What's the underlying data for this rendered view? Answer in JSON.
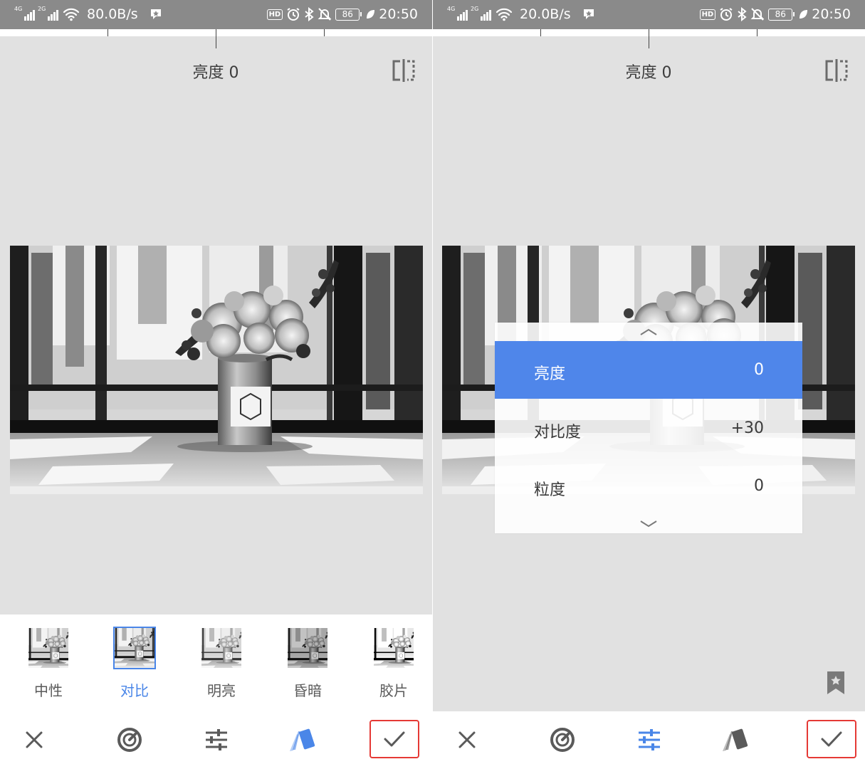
{
  "left_screen": {
    "status_bar": {
      "signal1": "4G",
      "signal2": "2G",
      "speed": "80.0B/s",
      "battery": "86",
      "time": "20:50"
    },
    "adjust_label": "亮度 0",
    "presets": [
      {
        "label": "中性",
        "selected": false
      },
      {
        "label": "对比",
        "selected": true
      },
      {
        "label": "明亮",
        "selected": false
      },
      {
        "label": "昏暗",
        "selected": false
      },
      {
        "label": "胶片",
        "selected": false
      }
    ],
    "toolbar": {
      "cancel_icon": "close-icon",
      "auto_icon": "tone-dial-icon",
      "tune_icon": "sliders-icon",
      "styles_icon": "styles-cards-icon",
      "styles_color": "#4a86e8",
      "confirm_icon": "checkmark-icon"
    }
  },
  "right_screen": {
    "status_bar": {
      "signal1": "4G",
      "signal2": "2G",
      "speed": "20.0B/s",
      "battery": "86",
      "time": "20:50"
    },
    "adjust_label": "亮度 0",
    "adjust_menu": [
      {
        "name": "亮度",
        "value": "0",
        "active": true
      },
      {
        "name": "对比度",
        "value": "+30",
        "active": false
      },
      {
        "name": "粒度",
        "value": "0",
        "active": false
      }
    ],
    "toolbar": {
      "cancel_icon": "close-icon",
      "auto_icon": "tone-dial-icon",
      "tune_icon": "sliders-icon",
      "tune_color": "#4a86e8",
      "styles_icon": "styles-cards-icon",
      "confirm_icon": "checkmark-icon"
    }
  },
  "colors": {
    "accent": "#4a86e8",
    "highlight_box": "#e53935",
    "menu_active": "#4f86ea",
    "canvas_bg": "#e1e1e1",
    "status_bar": "#8a8a8a"
  }
}
